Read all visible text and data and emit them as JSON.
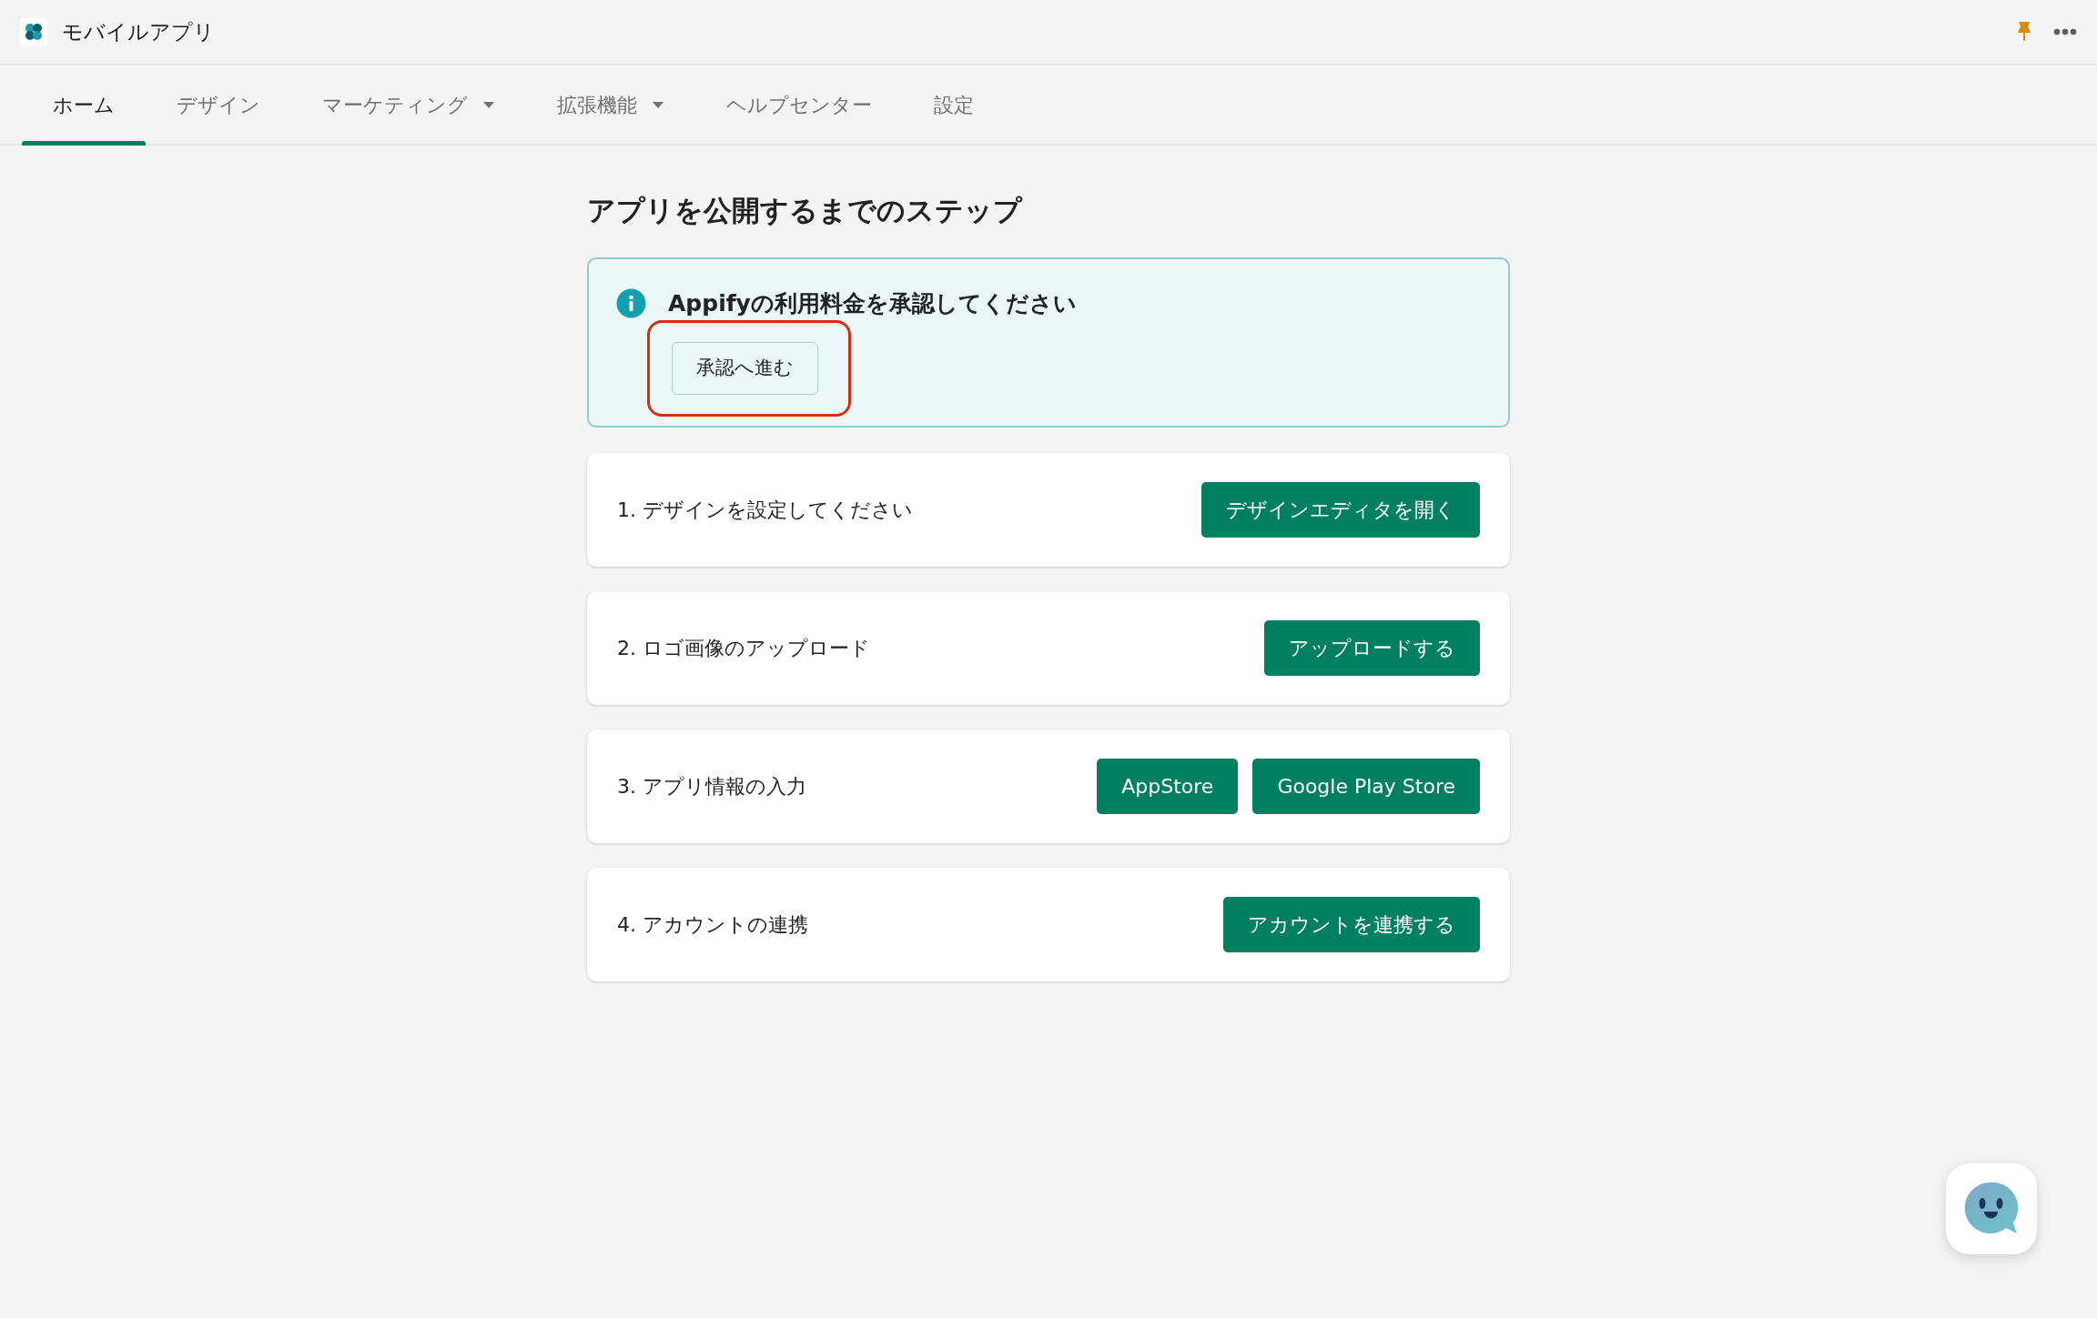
{
  "app": {
    "title": "モバイルアプリ"
  },
  "tabs": [
    {
      "label": "ホーム",
      "selected": true,
      "has_menu": false
    },
    {
      "label": "デザイン",
      "selected": false,
      "has_menu": false
    },
    {
      "label": "マーケティング",
      "selected": false,
      "has_menu": true
    },
    {
      "label": "拡張機能",
      "selected": false,
      "has_menu": true
    },
    {
      "label": "ヘルプセンター",
      "selected": false,
      "has_menu": false
    },
    {
      "label": "設定",
      "selected": false,
      "has_menu": false
    }
  ],
  "heading": "アプリを公開するまでのステップ",
  "banner": {
    "message": "Appifyの利用料金を承認してください",
    "button": {
      "label": "承認へ進む",
      "highlighted": true
    }
  },
  "steps": [
    {
      "label": "1. デザインを設定してください",
      "buttons": [
        "デザインエディタを開く"
      ]
    },
    {
      "label": "2. ロゴ画像のアップロード",
      "buttons": [
        "アップロードする"
      ]
    },
    {
      "label": "3. アプリ情報の入力",
      "buttons": [
        "AppStore",
        "Google Play Store"
      ]
    },
    {
      "label": "4. アカウントの連携",
      "buttons": [
        "アカウントを連携する"
      ]
    }
  ]
}
